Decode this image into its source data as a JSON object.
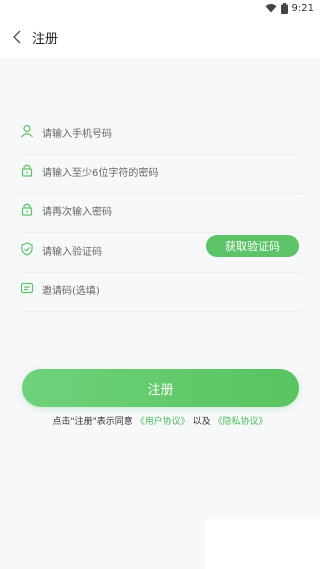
{
  "status_bar": {
    "time": "9:21"
  },
  "header": {
    "title": "注册"
  },
  "form": {
    "phone_placeholder": "请输入手机号码",
    "password_placeholder": "请输入至少6位字符的密码",
    "confirm_placeholder": "请再次输入密码",
    "code_placeholder": "请输入验证码",
    "get_code_label": "获取验证码",
    "invite_placeholder": "邀请码(选填)"
  },
  "register_label": "注册",
  "agreement": {
    "prefix": "点击\"注册\"表示同意",
    "user_agreement": "《用户协议》",
    "and": "以及",
    "privacy_agreement": "《隐私协议》"
  },
  "colors": {
    "accent": "#5cc467",
    "link": "#4cba5a",
    "background": "#f6f8fa"
  }
}
